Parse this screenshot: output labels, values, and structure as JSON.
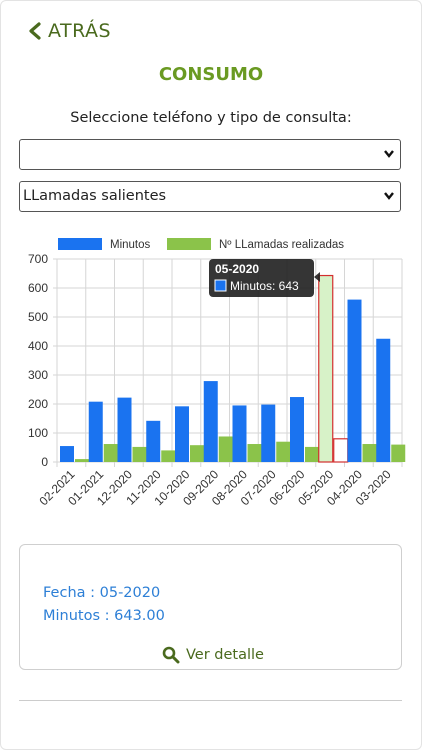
{
  "header": {
    "back_label": "ATRÁS",
    "title": "CONSUMO"
  },
  "form": {
    "prompt": "Seleccione teléfono y tipo de consulta:",
    "phone_select_value": "",
    "type_select_value": "LLamadas salientes"
  },
  "chart_data": {
    "type": "bar",
    "categories": [
      "02-2021",
      "01-2021",
      "12-2020",
      "11-2020",
      "10-2020",
      "09-2020",
      "08-2020",
      "07-2020",
      "06-2020",
      "05-2020",
      "04-2020",
      "03-2020"
    ],
    "series": [
      {
        "name": "Minutos",
        "color": "#1a73f0",
        "values": [
          55,
          208,
          222,
          142,
          192,
          279,
          195,
          198,
          224,
          643,
          560,
          425
        ]
      },
      {
        "name": "Nº LLamadas realizadas",
        "color": "#8bc34a",
        "values": [
          10,
          62,
          52,
          40,
          58,
          88,
          62,
          70,
          52,
          80,
          62,
          60
        ]
      }
    ],
    "ylim": [
      0,
      700
    ],
    "yticks": [
      0,
      100,
      200,
      300,
      400,
      500,
      600,
      700
    ],
    "grid": true,
    "legend": "top",
    "selected_index": 9,
    "tooltip": {
      "title": "05-2020",
      "label": "Minutos: 643"
    }
  },
  "detail_card": {
    "fecha": "Fecha : 05-2020",
    "minutos": "Minutos : 643.00",
    "link_label": "Ver detalle"
  },
  "colors": {
    "accent_green": "#6a9a22",
    "dark_green": "#4a6a1e",
    "link_blue": "#2d7fd6"
  }
}
